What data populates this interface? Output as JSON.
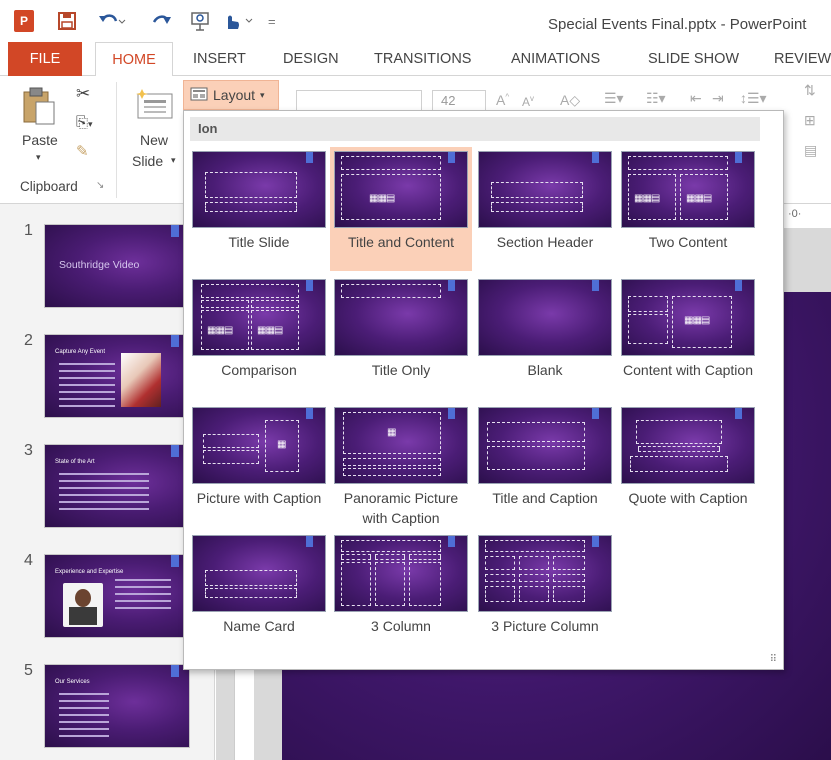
{
  "window": {
    "title": "Special Events Final.pptx - PowerPoint",
    "app_icon": "powerpoint-logo",
    "app_letter": "P"
  },
  "tabs": [
    {
      "label": "FILE"
    },
    {
      "label": "HOME",
      "active": true
    },
    {
      "label": "INSERT"
    },
    {
      "label": "DESIGN"
    },
    {
      "label": "TRANSITIONS"
    },
    {
      "label": "ANIMATIONS"
    },
    {
      "label": "SLIDE SHOW"
    },
    {
      "label": "REVIEW"
    }
  ],
  "ribbon": {
    "paste_label": "Paste",
    "new_label": "New",
    "slide_label": "Slide",
    "clipboard_group": "Clipboard",
    "layout_label": "Layout",
    "font_size": "42",
    "ruler_text": "·0·"
  },
  "gallery": {
    "header": "Ion",
    "items": [
      {
        "caption": "Title Slide"
      },
      {
        "caption": "Title and Content",
        "selected": true
      },
      {
        "caption": "Section Header"
      },
      {
        "caption": "Two Content"
      },
      {
        "caption": "Comparison"
      },
      {
        "caption": "Title Only"
      },
      {
        "caption": "Blank"
      },
      {
        "caption": "Content with Caption"
      },
      {
        "caption": "Picture with Caption"
      },
      {
        "caption": "Panoramic Picture with Caption"
      },
      {
        "caption": "Title and Caption"
      },
      {
        "caption": "Quote with Caption"
      },
      {
        "caption": "Name Card"
      },
      {
        "caption": "3 Column"
      },
      {
        "caption": "3 Picture Column"
      }
    ]
  },
  "slides": [
    {
      "number": "1",
      "title": "Southridge Video"
    },
    {
      "number": "2",
      "title": "Capture Any Event"
    },
    {
      "number": "3",
      "title": "State of the Art"
    },
    {
      "number": "4",
      "title": "Experience and Expertise"
    },
    {
      "number": "5",
      "title": "Our Services"
    }
  ],
  "colors": {
    "accent": "#d24726",
    "selected_bg": "#fbd0b8",
    "slide_purple": "#4a1c73"
  }
}
